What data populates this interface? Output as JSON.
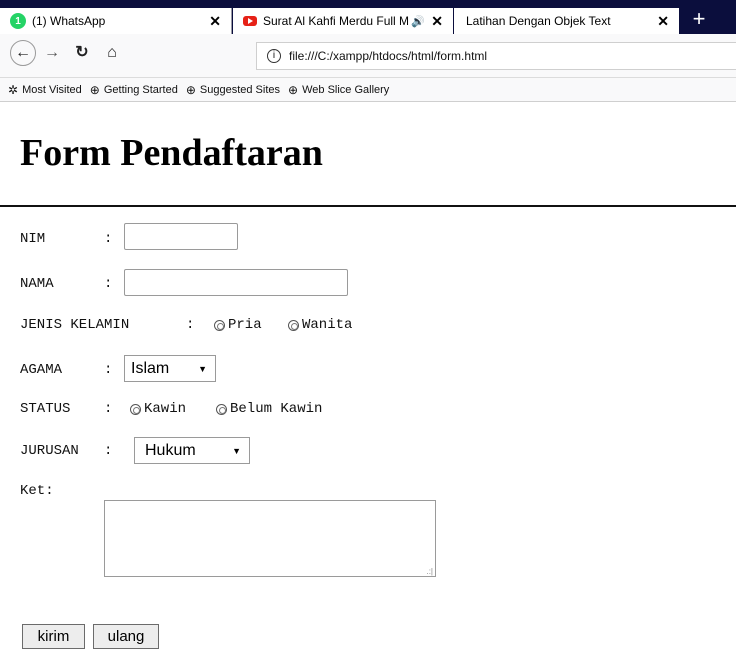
{
  "browser": {
    "tabs": [
      {
        "title": "(1) WhatsApp",
        "favicon": "whatsapp-icon"
      },
      {
        "title": "Surat Al Kahfi Merdu Full M",
        "favicon": "youtube-icon"
      },
      {
        "title": "Latihan Dengan Objek Text",
        "favicon": null
      }
    ],
    "url": "file:///C:/xampp/htdocs/html/form.html",
    "bookmarks": [
      "Most Visited",
      "Getting Started",
      "Suggested Sites",
      "Web Slice Gallery"
    ]
  },
  "page": {
    "title": "Form Pendaftaran",
    "fields": {
      "nim": {
        "label": "NIM",
        "sep": ":"
      },
      "nama": {
        "label": "NAMA",
        "sep": ":"
      },
      "jenis_kelamin": {
        "label": "JENIS KELAMIN",
        "sep": ":",
        "options": [
          "Pria",
          "Wanita"
        ]
      },
      "agama": {
        "label": "AGAMA",
        "sep": ":",
        "selected": "Islam"
      },
      "status": {
        "label": "STATUS",
        "sep": ":",
        "options": [
          "Kawin",
          "Belum Kawin"
        ]
      },
      "jurusan": {
        "label": "JURUSAN",
        "sep": ":",
        "selected": "Hukum"
      },
      "ket": {
        "label": "Ket:"
      }
    },
    "buttons": {
      "submit": "kirim",
      "reset": "ulang"
    }
  },
  "colors": {
    "tabbar": "#0b0e3d",
    "chrome": "#f9f9fa"
  }
}
